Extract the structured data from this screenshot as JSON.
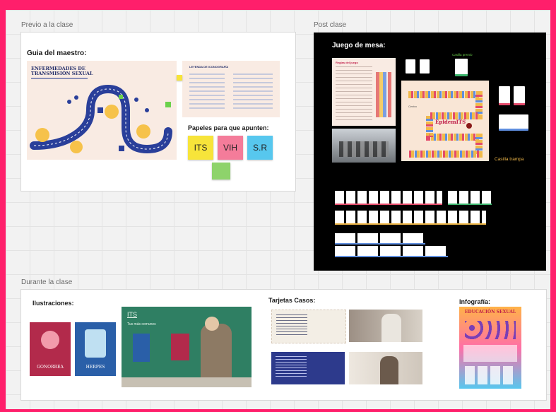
{
  "frames": {
    "previo": {
      "label": "Previo a la clase",
      "guia_title": "Guia del maestro:",
      "infographic_title": "ENFERMEDADES DE TRANSMISIÓN SEXUAL",
      "legend_title": "LEYENDA DE ICONOGRAFÍA",
      "papeles_title": "Papeles para que apunten:",
      "stickies": [
        "ITS",
        "VIH",
        "S.R"
      ]
    },
    "post": {
      "label": "Post clase",
      "juego_title": "Juego de mesa:",
      "reglas_title": "Reglas del juego",
      "board_name": "EpidemITS",
      "board_center": "Centro",
      "casilla_premio": "Casilla premio",
      "casilla_trampa": "Casilla trampa"
    },
    "durante": {
      "label": "Durante la clase",
      "ilustraciones_title": "Ilustraciones:",
      "ill_cards": [
        "GONORREA",
        "HERPES"
      ],
      "board_text_1": "ITS",
      "board_text_2": "Tus más comunes",
      "tarjetas_title": "Tarjetas Casos:",
      "infografia_title": "Infografía:",
      "infografia_header": "EDUCACIÓN SEXUAL"
    }
  },
  "colors": {
    "border": "#ff1f6b",
    "sticky_yellow": "#f7e43a",
    "sticky_pink": "#f47c9a",
    "sticky_blue": "#57c7ee",
    "sticky_green": "#8ed36b",
    "board_bg": "#000000"
  }
}
